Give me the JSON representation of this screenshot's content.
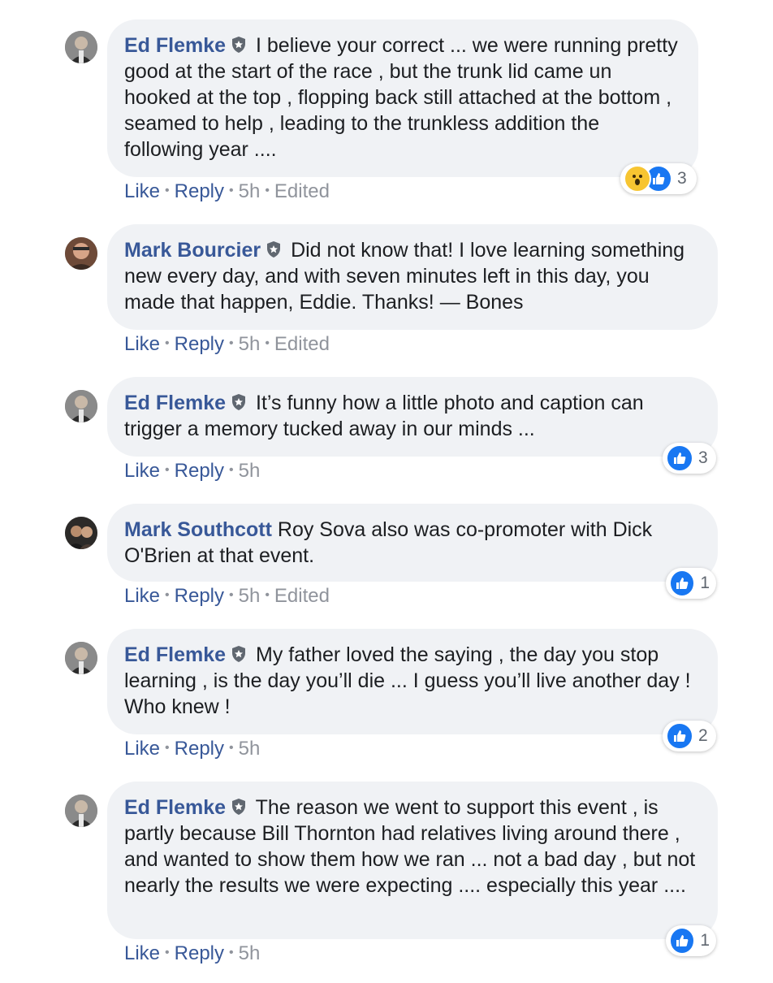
{
  "colors": {
    "link": "#385898",
    "bubble_bg": "#f0f2f5",
    "meta": "#90949c",
    "like_blue": "#1877f2",
    "wow_yellow": "#f7c531"
  },
  "actions": {
    "like": "Like",
    "reply": "Reply"
  },
  "comments": [
    {
      "author": "Ed Flemke",
      "badge_icon": "shield-icon",
      "text": "I believe your correct ... we were running pretty good at the start of the race , but the trunk lid came un hooked at the top , flopping back still attached at the bottom , seamed to help , leading to the trunkless addition the following year ....",
      "time": "5h",
      "edited": "Edited",
      "reactions": [
        "wow-icon",
        "like-icon"
      ],
      "reaction_count": "3"
    },
    {
      "author": "Mark Bourcier",
      "badge_icon": "shield-icon",
      "text": "Did not know that! I love learning something new every day, and with seven minutes left in this day, you made that happen, Eddie. Thanks! — Bones",
      "time": "5h",
      "edited": "Edited"
    },
    {
      "author": "Ed Flemke",
      "badge_icon": "shield-icon",
      "text": "It’s funny how a little photo and caption can trigger a memory tucked away in our minds ...",
      "time": "5h",
      "reactions": [
        "like-icon"
      ],
      "reaction_count": "3"
    },
    {
      "author": "Mark Southcott",
      "text": "Roy Sova also was co-promoter with Dick O'Brien at that event.",
      "time": "5h",
      "edited": "Edited",
      "reactions": [
        "like-icon"
      ],
      "reaction_count": "1"
    },
    {
      "author": "Ed Flemke",
      "badge_icon": "shield-icon",
      "text": "My father loved the saying , the day you stop learning , is the day you’ll die ... I guess you’ll live another day ! Who knew !",
      "time": "5h",
      "reactions": [
        "like-icon"
      ],
      "reaction_count": "2"
    },
    {
      "author": "Ed Flemke",
      "badge_icon": "shield-icon",
      "text": "The reason we went to support this event , is partly because Bill Thornton had relatives living around there , and wanted to show them how we ran ... not a bad day , but not nearly the results we were expecting .... especially this year ....",
      "time": "5h",
      "reactions": [
        "like-icon"
      ],
      "reaction_count": "1"
    }
  ]
}
